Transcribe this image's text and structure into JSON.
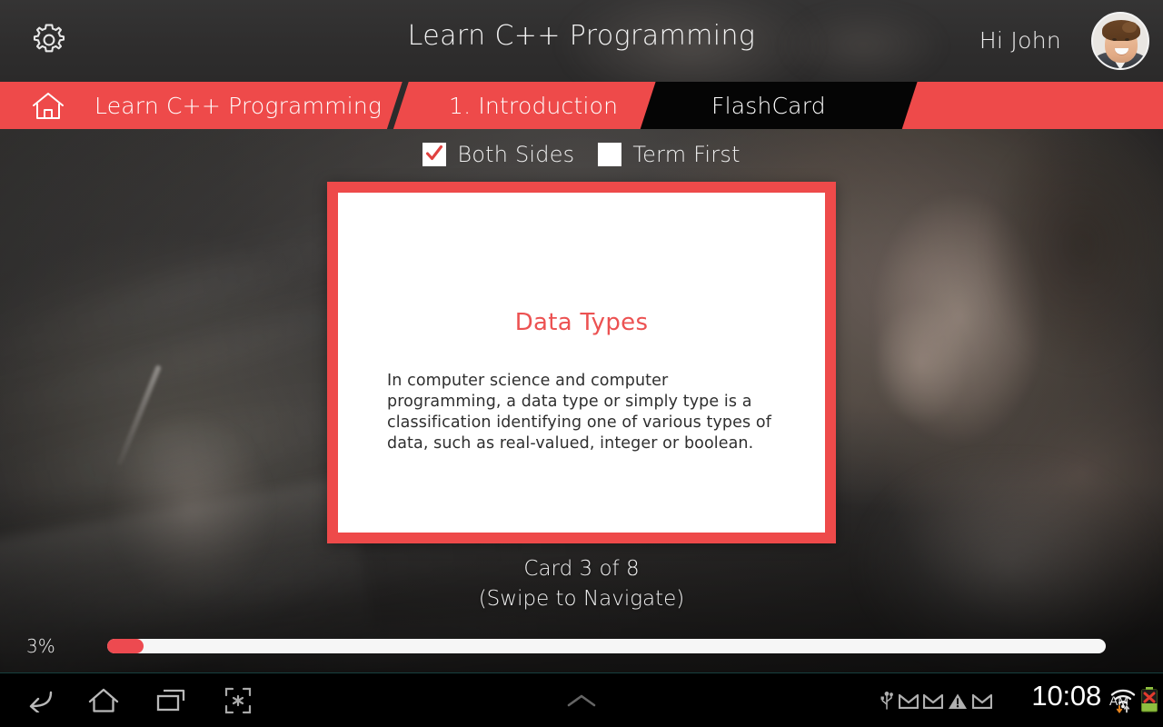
{
  "header": {
    "title": "Learn C++ Programming",
    "greeting": "Hi John",
    "gear_icon": "gear-icon",
    "avatar_alt": "User avatar"
  },
  "breadcrumb": {
    "home_icon": "home-icon",
    "items": [
      {
        "label": "Learn C++ Programming",
        "active": false
      },
      {
        "label": "1. Introduction",
        "active": false
      },
      {
        "label": "FlashCard",
        "active": true
      }
    ]
  },
  "options": [
    {
      "label": "Both Sides",
      "checked": true
    },
    {
      "label": "Term First",
      "checked": false
    }
  ],
  "flashcard": {
    "term": "Data Types",
    "definition": "In computer science and computer programming, a data type or simply type is a classification identifying one of various types of data, such as real-valued, integer or boolean.",
    "nav_line1": "Card 3 of 8",
    "nav_line2": "(Swipe to Navigate)",
    "current_card": 3,
    "total_cards": 8
  },
  "progress": {
    "percent_label": "3%",
    "percent_value": 3
  },
  "navbar": {
    "buttons": [
      {
        "name": "back-icon",
        "label": "Back"
      },
      {
        "name": "home-icon",
        "label": "Home"
      },
      {
        "name": "recents-icon",
        "label": "Recent apps"
      },
      {
        "name": "screenshot-icon",
        "label": "Screenshot"
      }
    ],
    "chevron": "chevron-up-icon",
    "status_icons": [
      "usb-icon",
      "gmail-icon",
      "gmail-icon",
      "warning-icon",
      "gmail-icon"
    ],
    "clock": "10:08",
    "ampm": "AM",
    "wifi_icon": "wifi-icon",
    "battery_icon": "battery-error-icon"
  },
  "colors": {
    "accent_red": "#ee4a4a",
    "card_term_red": "#ec5252",
    "header_dark": "#2e2d2d",
    "tab_black": "#050505",
    "progress_red": "#ed4a50"
  }
}
